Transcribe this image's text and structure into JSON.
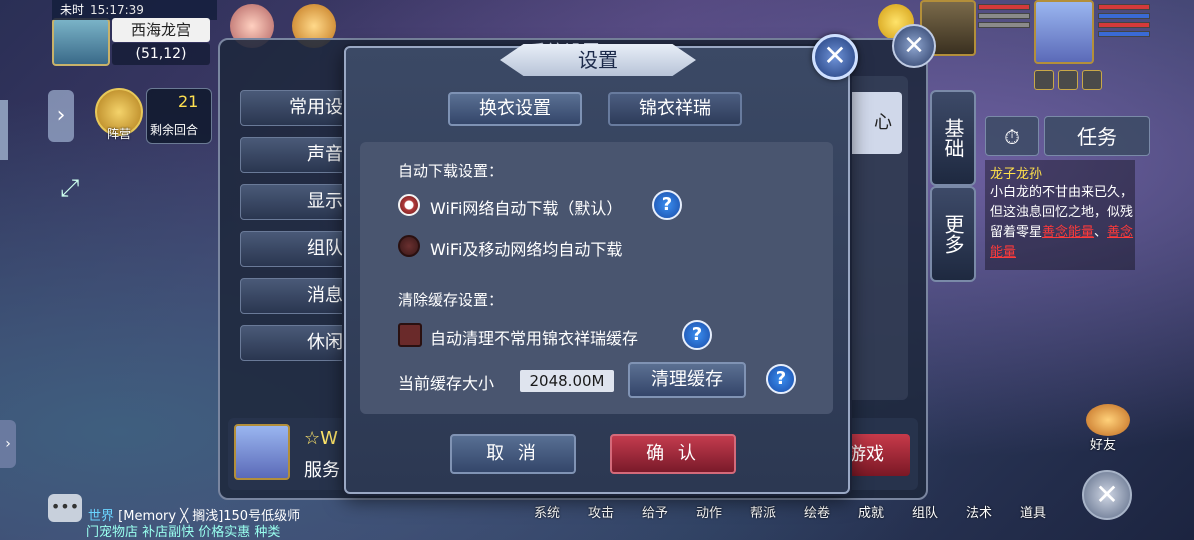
{
  "status": {
    "season": "未时",
    "clock": "15:17:39",
    "location": "西海龙宫",
    "coords": "(51,12)"
  },
  "combat": {
    "formation_label": "阵营",
    "turns_left": "21",
    "turns_label": "剩余回合"
  },
  "side_tabs": {
    "basic": "基础",
    "more": "更多"
  },
  "quest": {
    "task_button": "任务",
    "title": "龙子龙孙",
    "desc": "小白龙的不甘由来已久，但这浊息回忆之地，似残留着零星",
    "link1": "善念能量",
    "sep": "、",
    "link2": "善念能量"
  },
  "friends_label": "好友",
  "bottom_menu": [
    "系统",
    "攻击",
    "给予",
    "动作",
    "帮派",
    "绘卷",
    "成就",
    "组队",
    "法术",
    "道具"
  ],
  "chat": {
    "channel": "世界",
    "line1": "[Memory ╳ 搁浅]150号低级师",
    "line2": "门宠物店 补店副快 价格实惠 种类"
  },
  "bg_window": {
    "title": "系统设置",
    "menu": [
      "常用设",
      "声音",
      "显示",
      "组队",
      "消息",
      "休闲"
    ],
    "bright_text": "心",
    "player_name": "☆W",
    "player_server": "服务",
    "game_button": "游戏"
  },
  "dialog": {
    "title": "设置",
    "close_icon": "close-icon",
    "tabs": {
      "active": "换衣设置",
      "inactive": "锦衣祥瑞"
    },
    "auto_download": {
      "label": "自动下载设置：",
      "option1": "WiFi网络自动下载（默认）",
      "option2": "WiFi及移动网络均自动下载",
      "selected_option": 1
    },
    "clear_cache": {
      "label": "清除缓存设置：",
      "checkbox_label": "自动清理不常用锦衣祥瑞缓存",
      "checked": false
    },
    "cache_size": {
      "label": "当前缓存大小",
      "value": "2048.00M",
      "clear_button": "清理缓存"
    },
    "help_glyph": "?",
    "cancel": "取 消",
    "confirm": "确 认"
  },
  "colors": {
    "accent_red": "#c33b4e",
    "help_blue": "#2a6ed0",
    "quest_title": "#ffe04a",
    "quest_link": "#ff3a3a"
  }
}
